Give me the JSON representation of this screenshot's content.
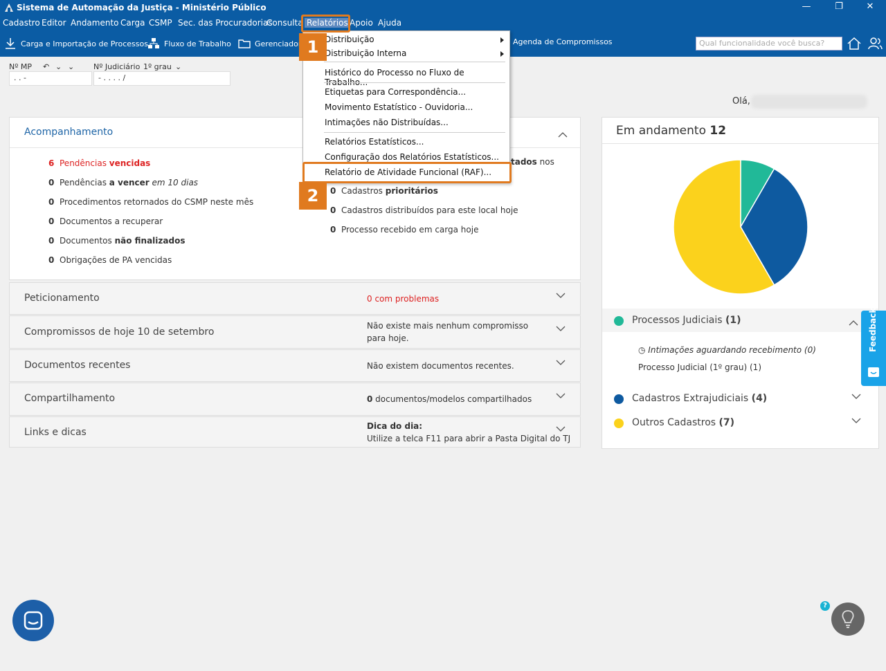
{
  "window": {
    "title": "Sistema de Automação da Justiça - Ministério Público",
    "minimize": "—",
    "restore": "❐",
    "close": "✕"
  },
  "menubar": {
    "items": [
      "Cadastro",
      "Editor",
      "Andamento",
      "Carga",
      "CSMP",
      "Sec. das Procuradorias",
      "Consulta",
      "Relatórios",
      "Apoio",
      "Ajuda"
    ],
    "active": "Relatórios"
  },
  "toolbar": {
    "carga_importacao": "Carga e Importação de Processos",
    "fluxo_trabalho": "Fluxo de Trabalho",
    "gerenciador": "Gerenciador",
    "agenda": "Agenda de Compromissos",
    "search_placeholder": "Qual funcionalidade você busca?"
  },
  "filters": {
    "mp_label": "Nº MP",
    "mp_value": ". . -",
    "judiciario_label": "Nº Judiciário",
    "grau": "1º grau",
    "judiciario_value": "- . . . .   /"
  },
  "greeting": "Olá,",
  "dropdown": {
    "distribuicao": "Distribuição",
    "distribuicao_interna": "Distribuição Interna",
    "historico": "Histórico do Processo no Fluxo de Trabalho...",
    "etiquetas": "Etiquetas para Correspondência...",
    "movimento": "Movimento Estatístico - Ouvidoria...",
    "intimacoes": "Intimações não Distribuídas...",
    "relatorios_estatisticos": "Relatórios Estatísticos...",
    "configuracao": "Configuração dos Relatórios Estatísticos...",
    "raf": "Relatório de Atividade Funcional (RAF)..."
  },
  "markers": {
    "one": "1",
    "two": "2"
  },
  "acompanhamento": {
    "title": "Acompanhamento",
    "left": [
      {
        "n": "6",
        "text": "Pendências ",
        "bold": "vencidas",
        "suffix": ""
      },
      {
        "n": "0",
        "text": "Pendências ",
        "bold": "a vencer",
        "suffix": " em 10 dias"
      },
      {
        "n": "0",
        "text": "Procedimentos retornados do CSMP neste mês",
        "bold": "",
        "suffix": ""
      },
      {
        "n": "0",
        "text": "Documentos a recuperar",
        "bold": "",
        "suffix": ""
      },
      {
        "n": "0",
        "text": "Documentos ",
        "bold": "não finalizados",
        "suffix": ""
      },
      {
        "n": "0",
        "text": "Obrigações de PA vencidas",
        "bold": "",
        "suffix": ""
      }
    ],
    "right_partial": "tados",
    "right_partial_suffix": " nos",
    "right": [
      {
        "n": "0",
        "text": "Cadastros ",
        "bold": "prioritários"
      },
      {
        "n": "0",
        "text": "Cadastros distribuídos para este local hoje",
        "bold": ""
      },
      {
        "n": "0",
        "text": "Processo recebido em carga hoje",
        "bold": ""
      }
    ]
  },
  "accordions": [
    {
      "title": "Peticionamento",
      "count": "0",
      "text": " com problemas"
    },
    {
      "title": "Compromissos de hoje 10 de setembro",
      "text": "Não existe mais nenhum compromisso para hoje."
    },
    {
      "title": "Documentos recentes",
      "text": "Não existem documentos recentes."
    },
    {
      "title": "Compartilhamento",
      "count": "0",
      "text": " documentos/modelos compartilhados"
    },
    {
      "title": "Links e dicas",
      "heading": "Dica do dia:",
      "text": "Utilize a telca F11 para abrir a Pasta Digital do TJ"
    }
  ],
  "andamento": {
    "title": "Em andamento",
    "total": "12",
    "judiciais": "Processos Judiciais",
    "judiciais_count": "(1)",
    "intimacoes_aguardando": "Intimações aguardando recebimento (0)",
    "processo_judicial": "Processo Judicial (1º grau) (1)",
    "extrajudiciais": "Cadastros Extrajudiciais",
    "extrajudiciais_count": "(4)",
    "outros": "Outros Cadastros",
    "outros_count": "(7)"
  },
  "chart_data": {
    "type": "pie",
    "categories": [
      "Processos Judiciais",
      "Cadastros Extrajudiciais",
      "Outros Cadastros"
    ],
    "values": [
      1,
      4,
      7
    ],
    "colors": [
      "#21b998",
      "#0e5aa0",
      "#fbd21c"
    ]
  },
  "feedback": "Feedback",
  "help": "?"
}
